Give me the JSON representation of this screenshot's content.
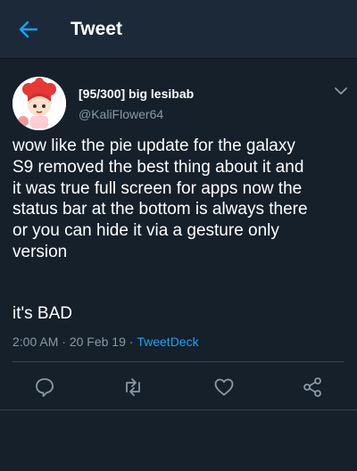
{
  "appbar": {
    "title": "Tweet"
  },
  "tweet": {
    "display_name": "[95/300] big lesibab",
    "handle": "@KaliFlower64",
    "text_main": "wow like the pie update for the galaxy\nS9 removed the best thing about it and\nit was true full screen for apps now the\nstatus bar at the bottom is always there\nor you can hide it via a gesture only\nversion",
    "text_end": "it's BAD",
    "time": "2:00 AM",
    "sep": " · ",
    "date": "20 Feb 19",
    "source": "TweetDeck"
  },
  "icons": {
    "back": "back-arrow-icon",
    "caret": "chevron-down-icon",
    "reply": "reply-icon",
    "retweet": "retweet-icon",
    "like": "heart-icon",
    "share": "share-icon"
  },
  "colors": {
    "background": "#15202b",
    "appbar": "#1c2938",
    "accent": "#1da1f2",
    "muted": "#8899a6"
  }
}
